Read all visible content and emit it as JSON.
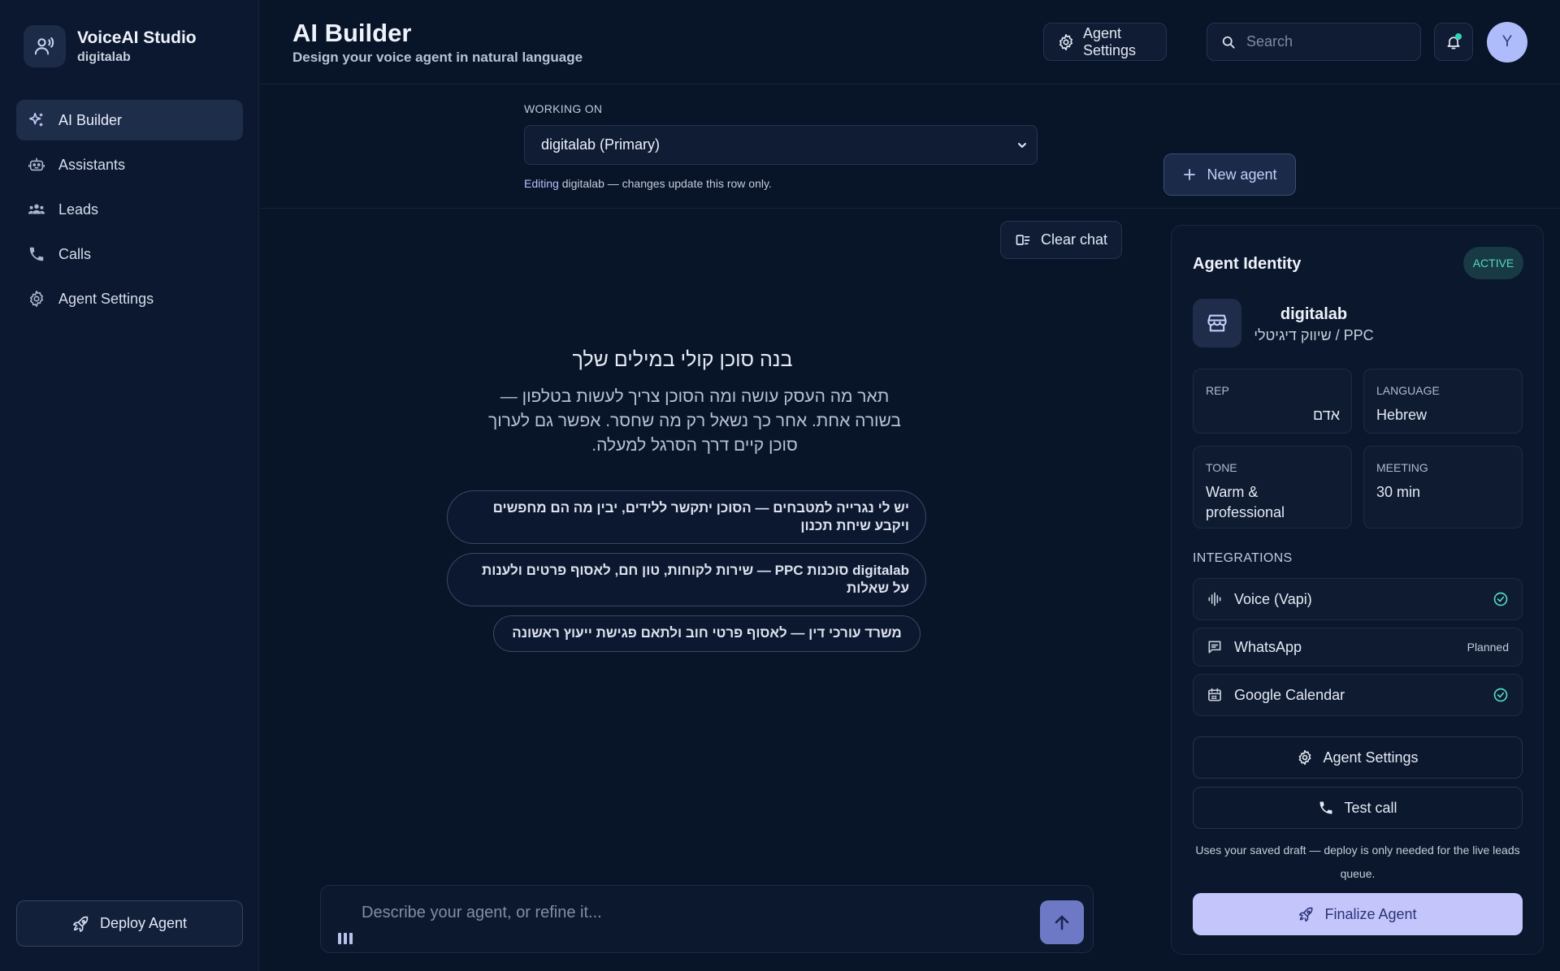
{
  "brand": {
    "title": "VoiceAI Studio",
    "subtitle": "digitalab"
  },
  "sidebar": {
    "items": [
      {
        "label": "AI Builder",
        "icon": "sparkles-icon",
        "active": true
      },
      {
        "label": "Assistants",
        "icon": "robot-icon"
      },
      {
        "label": "Leads",
        "icon": "users-icon"
      },
      {
        "label": "Calls",
        "icon": "phone-icon"
      },
      {
        "label": "Agent Settings",
        "icon": "gear-icon"
      }
    ],
    "deploy_label": "Deploy Agent"
  },
  "header": {
    "title": "AI Builder",
    "subtitle": "Design your voice agent in natural language",
    "settings_label": "Agent Settings",
    "search_placeholder": "Search",
    "avatar_initial": "Y"
  },
  "workbar": {
    "label": "WORKING ON",
    "selected": "digitalab (Primary)",
    "note_accent": "Editing",
    "note_text": " digitalab — changes update this row only.",
    "new_agent_label": "New agent"
  },
  "chat": {
    "clear_label": "Clear chat",
    "hero_title": "בנה סוכן קולי במילים שלך",
    "hero_desc": "תאר מה העסק עושה ומה הסוכן צריך לעשות בטלפון — בשורה אחת. אחר כך נשאל רק מה שחסר. אפשר גם לערוך סוכן קיים דרך הסרגל למעלה.",
    "suggestions": [
      "יש לי נגרייה למטבחים — הסוכן יתקשר ללידים, יבין מה הם מחפשים ויקבע שיחת תכנון",
      "digitalab סוכנות PPC — שירות לקוחות, טון חם, לאסוף פרטים ולענות על שאלות",
      "משרד עורכי דין — לאסוף פרטי חוב ולתאם פגישת ייעוץ ראשונה"
    ],
    "composer_placeholder": "Describe your agent, or refine it..."
  },
  "panel": {
    "title": "Agent Identity",
    "status": "ACTIVE",
    "agent_name": "digitalab",
    "agent_category": "PPC / שיווק דיגיטלי",
    "fields": {
      "rep": {
        "label": "REP",
        "value": "אדם"
      },
      "language": {
        "label": "LANGUAGE",
        "value": "Hebrew"
      },
      "tone": {
        "label": "TONE",
        "value": "Warm & professional"
      },
      "meeting": {
        "label": "MEETING",
        "value": "30 min"
      }
    },
    "integrations_label": "INTEGRATIONS",
    "integrations": [
      {
        "name": "Voice (Vapi)",
        "status": "connected"
      },
      {
        "name": "WhatsApp",
        "status": "Planned"
      },
      {
        "name": "Google Calendar",
        "status": "connected"
      }
    ],
    "settings_label": "Agent Settings",
    "test_call_label": "Test call",
    "draft_note": "Uses your saved draft — deploy is only needed for the live leads queue.",
    "finalize_label": "Finalize Agent"
  },
  "colors": {
    "background": "#081427",
    "accent": "#c4c6fb",
    "success": "#56d8c1",
    "send_button": "#6e79c6"
  }
}
